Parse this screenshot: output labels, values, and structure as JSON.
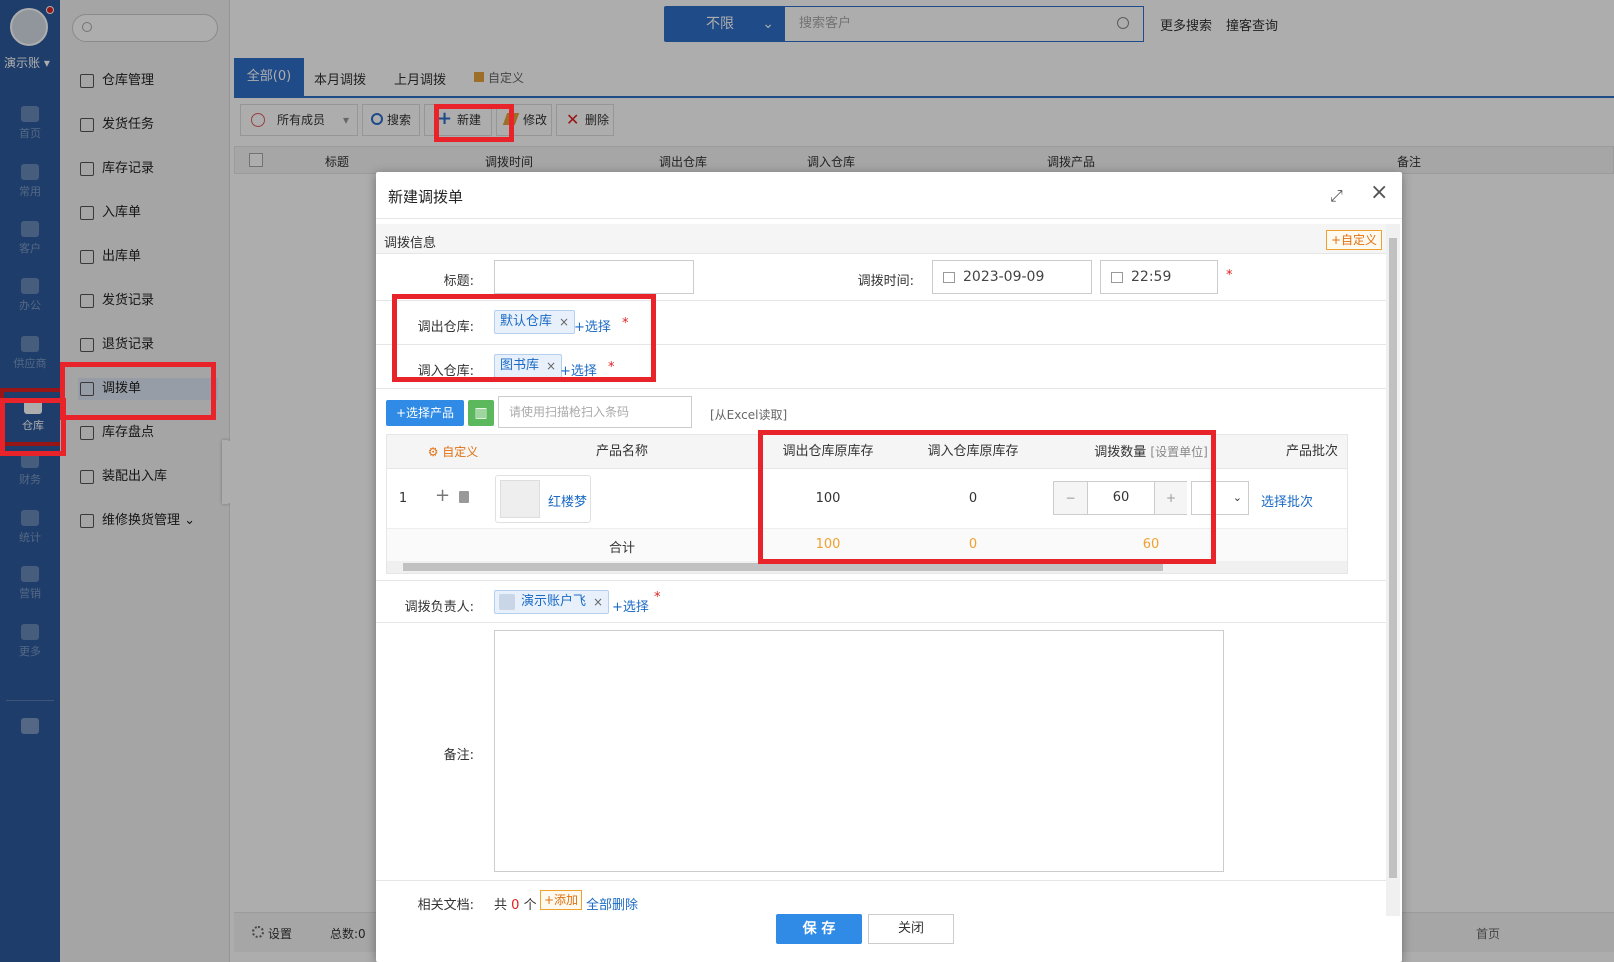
{
  "user": {
    "name": "演示账",
    "avatar_icon": "user-avatar-icon"
  },
  "rail": [
    {
      "label": "首页",
      "icon": "home-icon"
    },
    {
      "label": "常用",
      "icon": "grid-icon"
    },
    {
      "label": "客户",
      "icon": "customer-icon"
    },
    {
      "label": "办公",
      "icon": "monitor-icon"
    },
    {
      "label": "供应商",
      "icon": "supplier-icon"
    },
    {
      "label": "仓库",
      "icon": "warehouse-icon"
    },
    {
      "label": "财务",
      "icon": "money-bag-icon"
    },
    {
      "label": "统计",
      "icon": "chart-icon"
    },
    {
      "label": "营销",
      "icon": "marketing-icon"
    },
    {
      "label": "更多",
      "icon": "more-icon"
    }
  ],
  "submenu": [
    {
      "label": "仓库管理",
      "icon": "warehouse-icon"
    },
    {
      "label": "发货任务",
      "icon": "task-icon"
    },
    {
      "label": "库存记录",
      "icon": "record-icon"
    },
    {
      "label": "入库单",
      "icon": "inbound-icon"
    },
    {
      "label": "出库单",
      "icon": "outbound-icon"
    },
    {
      "label": "发货记录",
      "icon": "truck-icon"
    },
    {
      "label": "退货记录",
      "icon": "return-icon"
    },
    {
      "label": "调拨单",
      "icon": "transfer-icon"
    },
    {
      "label": "库存盘点",
      "icon": "inventory-icon"
    },
    {
      "label": "装配出入库",
      "icon": "assembly-icon"
    },
    {
      "label": "维修换货管理",
      "icon": "repair-icon"
    }
  ],
  "topbar": {
    "scope_select": "不限",
    "search_placeholder": "搜索客户",
    "more_search": "更多搜索",
    "dup_check": "撞客查询"
  },
  "tabs": [
    {
      "label": "全部(0)"
    },
    {
      "label": "本月调拨"
    },
    {
      "label": "上月调拨"
    },
    {
      "label": "自定义"
    }
  ],
  "toolbar": {
    "members": "所有成员",
    "search": "搜索",
    "new": "新建",
    "edit": "修改",
    "delete": "删除"
  },
  "table_headers": [
    "标题",
    "调拨时间",
    "调出仓库",
    "调入仓库",
    "调拨产品",
    "备注"
  ],
  "footer": {
    "settings": "设置",
    "total": "总数:0",
    "first_page": "首页"
  },
  "modal": {
    "title": "新建调拨单",
    "section": "调拨信息",
    "customize": "+自定义",
    "title_label": "标题:",
    "time_label": "调拨时间:",
    "date": "2023-09-09",
    "time": "22:59",
    "out_label": "调出仓库:",
    "out_tag": "默认仓库",
    "in_label": "调入仓库:",
    "in_tag": "图书库",
    "pick": "+选择",
    "select_product": "+选择产品",
    "barcode_placeholder": "请使用扫描枪扫入条码",
    "excel": "[从Excel读取]",
    "grid_headers": {
      "custom": "自定义",
      "name": "产品名称",
      "out_stock": "调出仓库原库存",
      "in_stock": "调入仓库原库存",
      "qty": "调拨数量",
      "unit": "[设置单位]",
      "batch": "产品批次"
    },
    "row": {
      "index": "1",
      "product": "红楼梦",
      "out_stock": "100",
      "in_stock": "0",
      "qty": "60",
      "batch_link": "选择批次"
    },
    "total": {
      "label": "合计",
      "out_stock": "100",
      "in_stock": "0",
      "qty": "60"
    },
    "owner_label": "调拨负责人:",
    "owner_tag": "演示账户飞",
    "remark_label": "备注:",
    "docs_label": "相关文档:",
    "docs_count_prefix": "共",
    "docs_count": "0",
    "docs_count_suffix": "个",
    "add": "+添加",
    "delete_all": "全部删除",
    "save": "保 存",
    "close": "关闭"
  }
}
